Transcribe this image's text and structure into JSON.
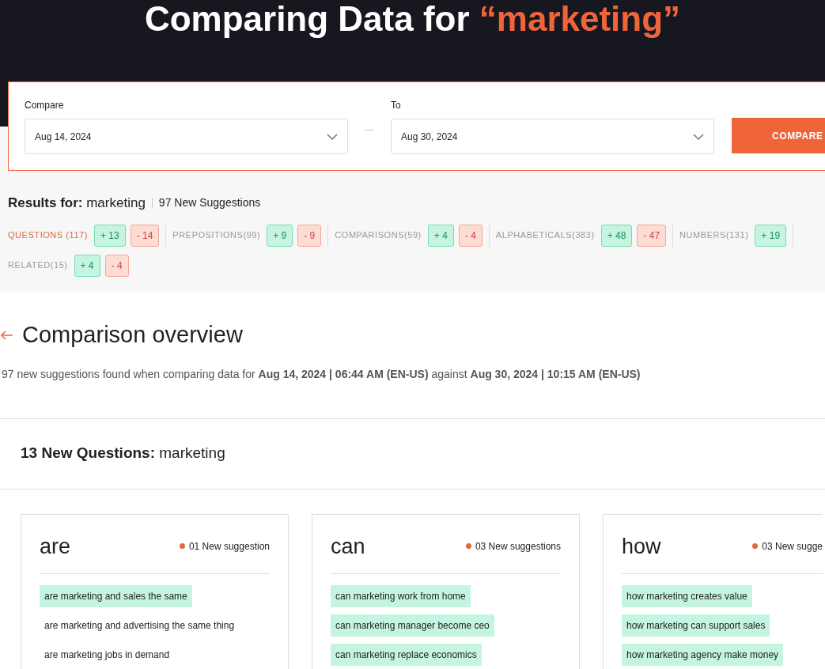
{
  "header": {
    "title": "Comparing Data for ",
    "keyword": "“marketing”"
  },
  "compare_form": {
    "from_label": "Compare",
    "from_value": "Aug 14, 2024",
    "separator": "—",
    "to_label": "To",
    "to_value": "Aug 30, 2024",
    "button": "COMPARE"
  },
  "results": {
    "label": "Results for:",
    "keyword": "marketing",
    "count": "97 New Suggestions"
  },
  "categories": [
    {
      "label": "QUESTIONS (117)",
      "selected": true,
      "plus": "+ 13",
      "minus": "- 14"
    },
    {
      "label": "PREPOSITIONS(99)",
      "selected": false,
      "plus": "+ 9",
      "minus": "- 9"
    },
    {
      "label": "COMPARISONS(59)",
      "selected": false,
      "plus": "+ 4",
      "minus": "- 4"
    },
    {
      "label": "ALPHABETICALS(383)",
      "selected": false,
      "plus": "+ 48",
      "minus": "- 47"
    },
    {
      "label": "NUMBERS(131)",
      "selected": false,
      "plus": "+ 19"
    },
    {
      "label": "RELATED(15)",
      "selected": false,
      "plus": "+ 4",
      "minus": "- 4"
    }
  ],
  "overview": {
    "title": "Comparison overview",
    "summary": "97 new suggestions found when comparing data for **Aug 14, 2024 | 06:44 AM (EN-US)** against **Aug 30, 2024 | 10:15 AM (EN-US)**"
  },
  "section": {
    "count": "13 New Questions:",
    "keyword": "marketing"
  },
  "cards": [
    {
      "word": "are",
      "count": "01 New suggestion",
      "suggestions": [
        {
          "text": "are marketing and sales the same",
          "is_new": true
        },
        {
          "text": "are marketing and advertising the same thing",
          "is_new": false
        },
        {
          "text": "are marketing jobs in demand",
          "is_new": false
        }
      ]
    },
    {
      "word": "can",
      "count": "03 New suggestions",
      "suggestions": [
        {
          "text": "can marketing work from home",
          "is_new": true
        },
        {
          "text": "can marketing manager become ceo",
          "is_new": true
        },
        {
          "text": "can marketing replace economics",
          "is_new": true
        }
      ]
    },
    {
      "word": "how",
      "count": "03 New sugge",
      "suggestions": [
        {
          "text": "how marketing creates value",
          "is_new": true
        },
        {
          "text": "how marketing can support sales",
          "is_new": true
        },
        {
          "text": "how marketing agency make money",
          "is_new": true
        }
      ]
    }
  ]
}
